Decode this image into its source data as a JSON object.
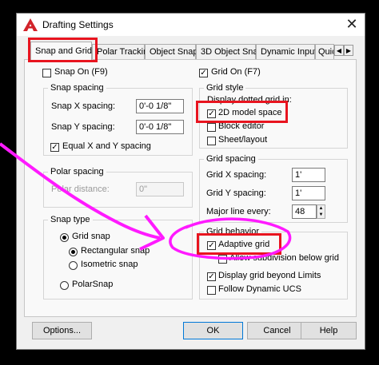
{
  "window": {
    "title": "Drafting Settings",
    "close_glyph": "✕"
  },
  "tabs": [
    {
      "label": "Snap and Grid"
    },
    {
      "label": "Polar Tracking"
    },
    {
      "label": "Object Snap"
    },
    {
      "label": "3D Object Snap"
    },
    {
      "label": "Dynamic Input"
    },
    {
      "label": "Quic"
    }
  ],
  "snap": {
    "snap_on_label": "Snap On (F9)",
    "spacing_group": "Snap spacing",
    "x_label": "Snap X spacing:",
    "x_value": "0'-0 1/8\"",
    "y_label": "Snap Y spacing:",
    "y_value": "0'-0 1/8\"",
    "equal_label": "Equal X and Y spacing",
    "polar_group": "Polar spacing",
    "polar_label": "Polar distance:",
    "polar_value": "0\"",
    "type_group": "Snap type",
    "grid_snap": "Grid snap",
    "rectangular_snap": "Rectangular snap",
    "isometric_snap": "Isometric snap",
    "polar_snap": "PolarSnap"
  },
  "grid": {
    "grid_on_label": "Grid On (F7)",
    "style_group": "Grid style",
    "style_caption": "Display dotted grid in:",
    "model_space": "2D model space",
    "block_editor": "Block editor",
    "sheet_layout": "Sheet/layout",
    "spacing_group": "Grid spacing",
    "x_label": "Grid X spacing:",
    "x_value": "1'",
    "y_label": "Grid Y spacing:",
    "y_value": "1'",
    "major_label": "Major line every:",
    "major_value": "48",
    "behavior_group": "Grid behavior",
    "adaptive": "Adaptive grid",
    "subdivision": "Allow subdivision below grid",
    "beyond_limits": "Display grid beyond Limits",
    "dynamic_ucs": "Follow Dynamic UCS"
  },
  "buttons": {
    "options": "Options...",
    "ok": "OK",
    "cancel": "Cancel",
    "help": "Help"
  },
  "colors": {
    "highlight_red": "#e8141f",
    "arrow_magenta": "#ff1aff",
    "accent_blue": "#0078d7"
  },
  "icons": {
    "app": "autocad-a-icon",
    "close": "close-icon",
    "check": "checkmark-icon",
    "arrow_left": "arrow-left-icon",
    "arrow_right": "arrow-right-icon",
    "spin": "spin-updown-icon"
  }
}
